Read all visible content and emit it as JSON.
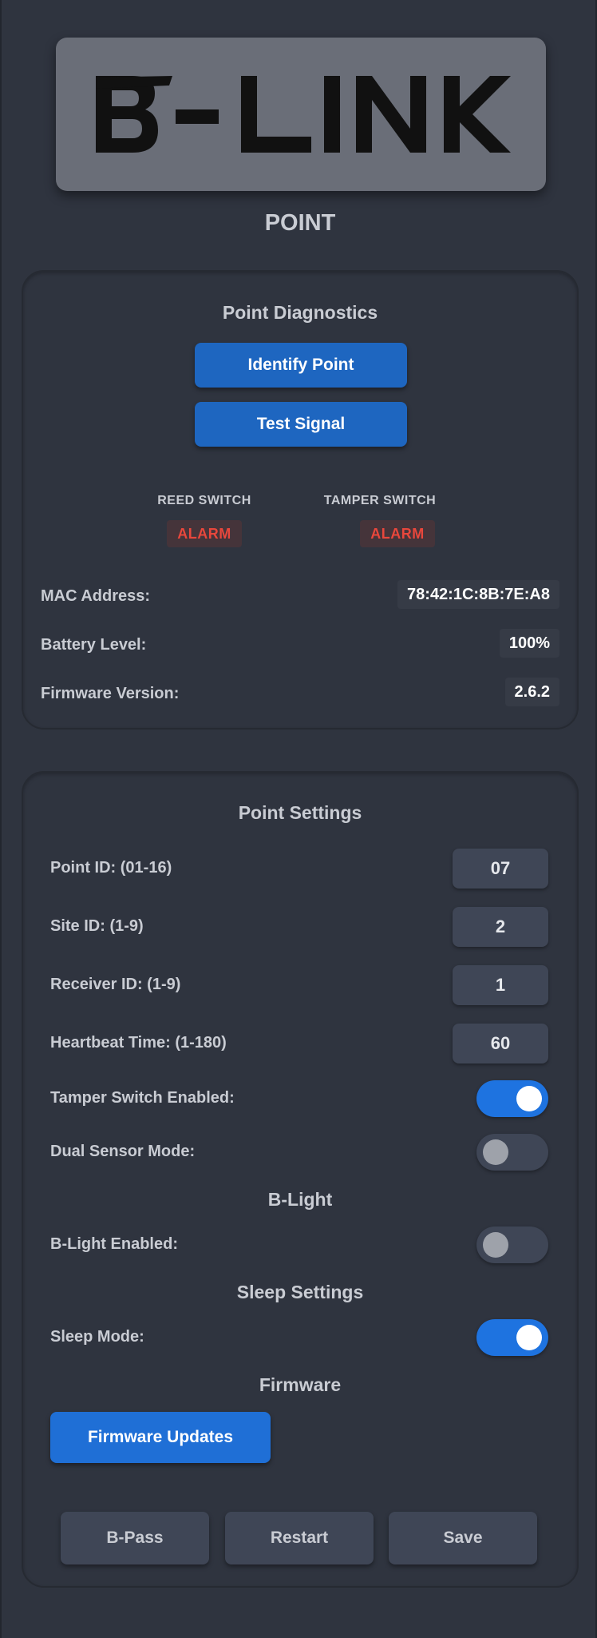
{
  "logo": {
    "text": "B-LINK"
  },
  "page_title": "POINT",
  "diagnostics": {
    "title": "Point Diagnostics",
    "identify_label": "Identify Point",
    "test_signal_label": "Test Signal",
    "reed_switch": {
      "label": "REED SWITCH",
      "status": "ALARM"
    },
    "tamper_switch": {
      "label": "TAMPER SWITCH",
      "status": "ALARM"
    },
    "info": [
      {
        "label": "MAC Address:",
        "value": "78:42:1C:8B:7E:A8"
      },
      {
        "label": "Battery Level:",
        "value": "100%"
      },
      {
        "label": "Firmware Version:",
        "value": "2.6.2"
      }
    ]
  },
  "settings": {
    "title": "Point Settings",
    "fields": [
      {
        "label": "Point ID: (01-16)",
        "value": "07"
      },
      {
        "label": "Site ID: (1-9)",
        "value": "2"
      },
      {
        "label": "Receiver ID: (1-9)",
        "value": "1"
      },
      {
        "label": "Heartbeat Time: (1-180)",
        "value": "60"
      }
    ],
    "toggles": {
      "tamper": {
        "label": "Tamper Switch Enabled:",
        "enabled": true
      },
      "dual_sensor": {
        "label": "Dual Sensor Mode:",
        "enabled": false
      },
      "blight": {
        "label": "B-Light Enabled:",
        "enabled": false
      },
      "sleep": {
        "label": "Sleep Mode:",
        "enabled": true
      }
    },
    "blight_title": "B-Light",
    "sleep_title": "Sleep Settings",
    "firmware_title": "Firmware",
    "firmware_updates_label": "Firmware Updates",
    "footer": {
      "bpass_label": "B-Pass",
      "restart_label": "Restart",
      "save_label": "Save"
    }
  },
  "colors": {
    "background": "#2f343f",
    "accent": "#1e66c0",
    "toggle_on": "#1e73e0",
    "alarm": "#e8473c"
  }
}
